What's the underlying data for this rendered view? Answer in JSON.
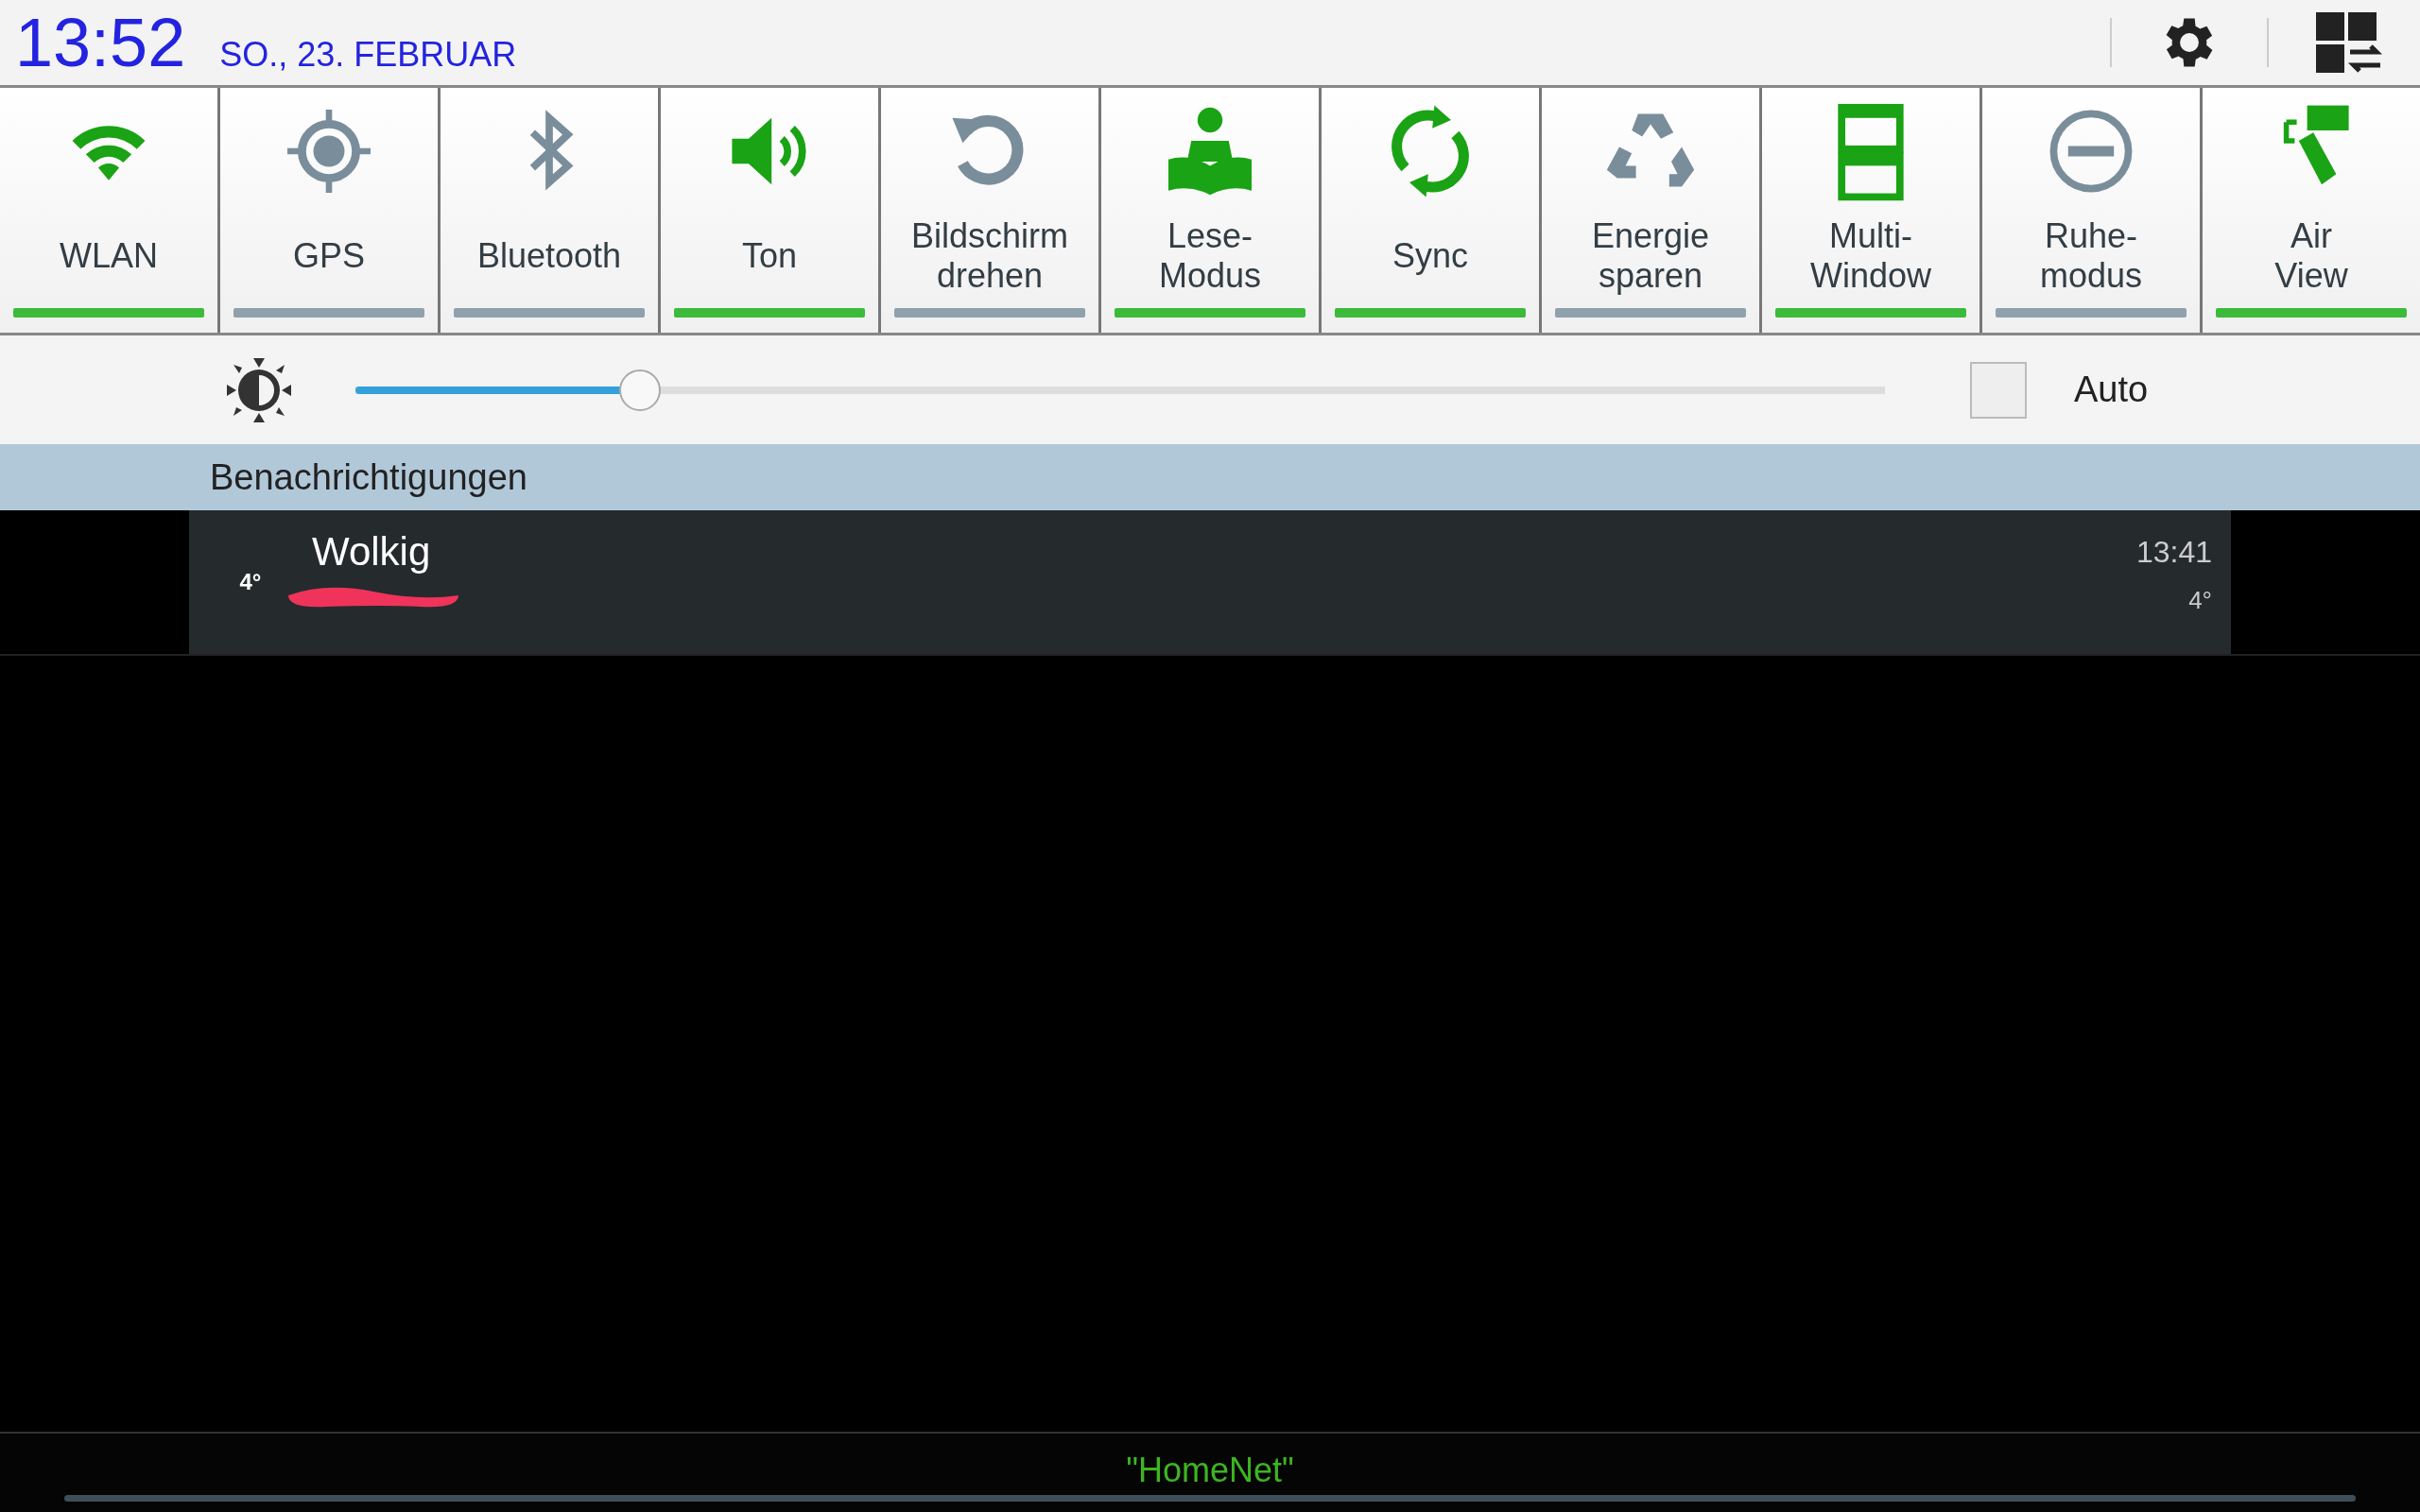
{
  "status": {
    "time": "13:52",
    "date": "SO., 23. FEBRUAR"
  },
  "toggles": [
    {
      "label": "WLAN",
      "on": true
    },
    {
      "label": "GPS",
      "on": false
    },
    {
      "label": "Bluetooth",
      "on": false
    },
    {
      "label": "Ton",
      "on": true
    },
    {
      "label": "Bildschirm drehen",
      "on": false
    },
    {
      "label": "Lese-Modus",
      "on": true
    },
    {
      "label": "Sync",
      "on": true
    },
    {
      "label": "Energie sparen",
      "on": false
    },
    {
      "label": "Multi-Window",
      "on": true
    },
    {
      "label": "Ruhe-modus",
      "on": false
    },
    {
      "label": "Air View",
      "on": true
    }
  ],
  "brightness": {
    "level": 0.186,
    "auto": {
      "label": "Auto",
      "checked": false
    }
  },
  "notifications": {
    "header": "Benachrichtigungen",
    "items": [
      {
        "icon_text": "4°",
        "title": "Wolkig",
        "time": "13:41",
        "info": "4°"
      }
    ]
  },
  "footer": {
    "network": "\"HomeNet\""
  }
}
